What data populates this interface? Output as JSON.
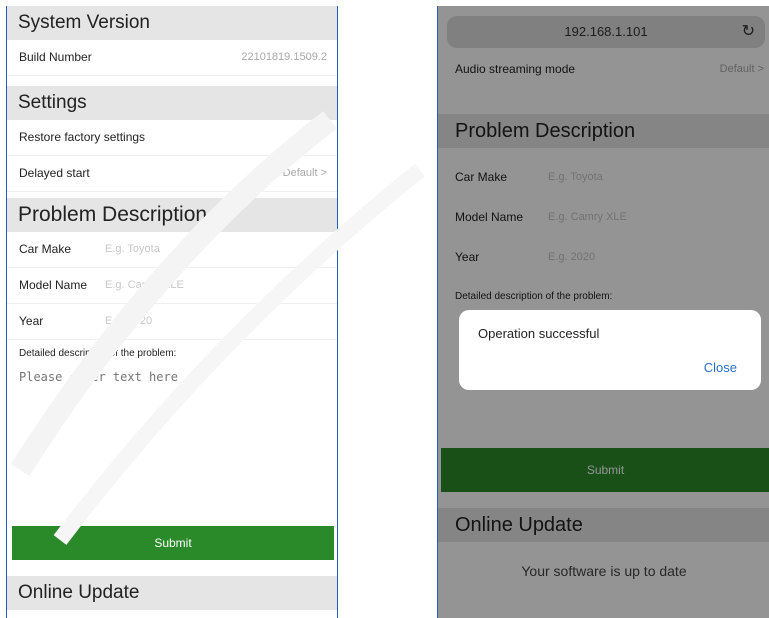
{
  "left": {
    "system_version": {
      "title": "System Version",
      "build_label": "Build Number",
      "build_value": "22101819.1509.2"
    },
    "settings": {
      "title": "Settings",
      "restore_label": "Restore factory settings",
      "restore_chevron": ">",
      "delayed_label": "Delayed start",
      "delayed_value": "Default >"
    },
    "problem": {
      "title": "Problem Description",
      "car_make_label": "Car Make",
      "car_make_placeholder": "E.g. Toyota",
      "model_label": "Model Name",
      "model_placeholder": "E.g. Camry XLE",
      "year_label": "Year",
      "year_placeholder": "E.g. 2020",
      "desc_label": "Detailed description of the problem:",
      "desc_placeholder": "Please enter text here",
      "submit_label": "Submit"
    },
    "online_update": {
      "title": "Online Update"
    }
  },
  "right": {
    "url": "192.168.1.101",
    "reload_icon": "↻",
    "audio_label": "Audio streaming mode",
    "audio_value": "Default >",
    "problem": {
      "title": "Problem Description",
      "car_make_label": "Car Make",
      "car_make_placeholder": "E.g. Toyota",
      "model_label": "Model Name",
      "model_placeholder": "E.g. Camry XLE",
      "year_label": "Year",
      "year_placeholder": "E.g. 2020",
      "desc_label": "Detailed description of the problem:",
      "submit_label": "Submit"
    },
    "online_update": {
      "title": "Online Update",
      "status": "Your software is up to date"
    },
    "dialog": {
      "message": "Operation successful",
      "close_label": "Close"
    }
  },
  "colors": {
    "submit_green": "#2a8a2a",
    "section_gray": "#e5e5e5",
    "link_blue": "#2a6fc4"
  }
}
